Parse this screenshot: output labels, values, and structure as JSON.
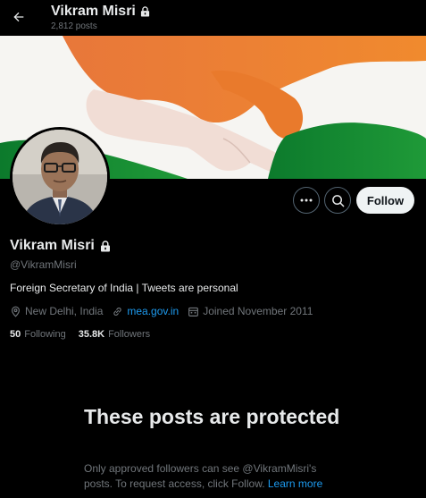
{
  "header": {
    "title": "Vikram Misri",
    "posts_count": "2,812 posts"
  },
  "profile": {
    "name": "Vikram Misri",
    "handle": "@VikramMisri",
    "bio": "Foreign Secretary of India | Tweets are personal",
    "location": "New Delhi, India",
    "website": "mea.gov.in",
    "joined": "Joined November 2011",
    "following_count": "50",
    "following_label": "Following",
    "followers_count": "35.8K",
    "followers_label": "Followers"
  },
  "actions": {
    "follow_label": "Follow"
  },
  "protected_notice": {
    "title": "These posts are protected",
    "body": "Only approved followers can see @VikramMisri's posts. To request access, click Follow.",
    "learn_more": "Learn more"
  },
  "icons": {
    "back": "arrow-left-icon",
    "lock": "lock-icon",
    "more": "more-icon",
    "search": "search-icon",
    "location": "location-icon",
    "link": "link-icon",
    "calendar": "calendar-icon"
  },
  "colors": {
    "background": "#000000",
    "text_primary": "#e7e9ea",
    "text_secondary": "#71767b",
    "accent": "#1d9bf0",
    "follow_bg": "#eff3f4"
  }
}
